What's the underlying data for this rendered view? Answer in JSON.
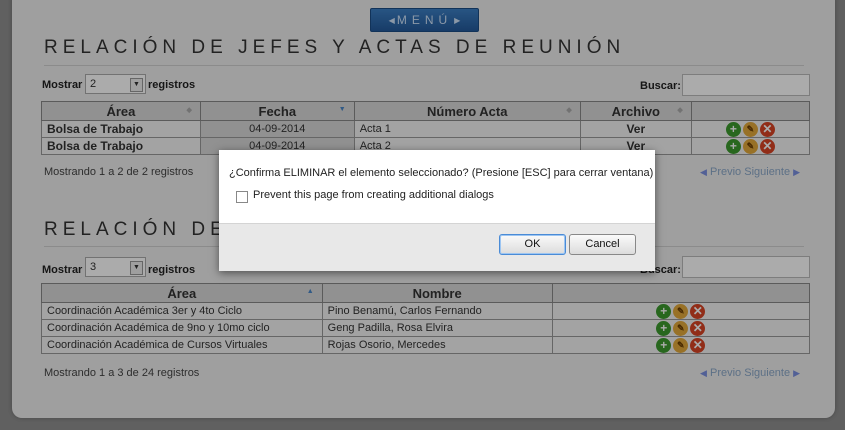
{
  "menu": {
    "label": "MENÚ"
  },
  "section1": {
    "title": "RELACIÓN DE JEFES Y ACTAS DE REUNIÓN",
    "show_label": "Mostrar",
    "show_value": "2",
    "registros_label": "registros",
    "search_label": "Buscar:",
    "columns": [
      "Área",
      "Fecha",
      "Número Acta",
      "Archivo"
    ],
    "rows": [
      {
        "area": "Bolsa de Trabajo",
        "fecha": "04-09-2014",
        "acta": "Acta 1",
        "archivo": "Ver"
      },
      {
        "area": "Bolsa de Trabajo",
        "fecha": "04-09-2014",
        "acta": "Acta 2",
        "archivo": "Ver"
      }
    ],
    "info": "Mostrando 1 a 2 de 2 registros",
    "prev": "Previo",
    "next": "Siguiente"
  },
  "section2": {
    "title": "RELACIÓN DE JEFES",
    "show_label": "Mostrar",
    "show_value": "3",
    "registros_label": "registros",
    "search_label": "Buscar:",
    "columns": [
      "Área",
      "Nombre"
    ],
    "rows": [
      {
        "area": "Coordinación Académica 3er y 4to Ciclo",
        "nombre": "Pino Benamú, Carlos Fernando"
      },
      {
        "area": "Coordinación Académica de 9no y 10mo ciclo",
        "nombre": "Geng Padilla, Rosa Elvira"
      },
      {
        "area": "Coordinación Académica de Cursos Virtuales",
        "nombre": "Rojas Osorio, Mercedes"
      }
    ],
    "info": "Mostrando 1 a 3 de 24 registros",
    "prev": "Previo",
    "next": "Siguiente"
  },
  "dialog": {
    "message": "¿Confirma ELIMINAR el elemento seleccionado? (Presione [ESC] para cerrar ventana)",
    "checkbox_label": "Prevent this page from creating additional dialogs",
    "ok": "OK",
    "cancel": "Cancel"
  },
  "icons": {
    "add": "plus-icon",
    "edit": "pencil-icon",
    "delete": "x-icon"
  }
}
